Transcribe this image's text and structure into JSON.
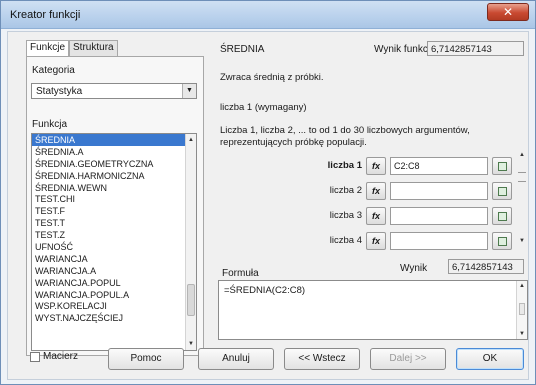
{
  "window": {
    "title": "Kreator funkcji",
    "close_symbol": "✕"
  },
  "left": {
    "tabs": [
      "Funkcje",
      "Struktura"
    ],
    "category_label": "Kategoria",
    "category_value": "Statystyka",
    "function_label": "Funkcja",
    "functions": [
      "ŚREDNIA",
      "ŚREDNIA.A",
      "ŚREDNIA.GEOMETRYCZNA",
      "ŚREDNIA.HARMONICZNA",
      "ŚREDNIA.WEWN",
      "TEST.CHI",
      "TEST.F",
      "TEST.T",
      "TEST.Z",
      "UFNOŚĆ",
      "WARIANCJA",
      "WARIANCJA.A",
      "WARIANCJA.POPUL",
      "WARIANCJA.POPUL.A",
      "WSP.KORELACJI",
      "WYST.NAJCZĘŚCIEJ"
    ],
    "selected_index": 0
  },
  "right": {
    "function_name": "ŚREDNIA",
    "result_label": "Wynik funkcji",
    "result_value": "6,7142857143",
    "description": "Zwraca średnią z próbki.",
    "arg_name": "liczba 1 (wymagany)",
    "arg_description": "Liczba 1, liczba 2, ... to od 1 do 30 liczbowych argumentów, reprezentujących próbkę populacji.",
    "args": [
      {
        "label": "liczba 1",
        "value": "C2:C8"
      },
      {
        "label": "liczba 2",
        "value": ""
      },
      {
        "label": "liczba 3",
        "value": ""
      },
      {
        "label": "liczba 4",
        "value": ""
      }
    ],
    "fx_label": "fx",
    "formula_label": "Formuła",
    "formula_value": "=ŚREDNIA(C2:C8)",
    "wynik_label": "Wynik",
    "wynik_value": "6,7142857143"
  },
  "footer": {
    "matrix_label": "Macierz",
    "help": "Pomoc",
    "cancel": "Anuluj",
    "back": "<< Wstecz",
    "next": "Dalej >>",
    "ok": "OK"
  }
}
